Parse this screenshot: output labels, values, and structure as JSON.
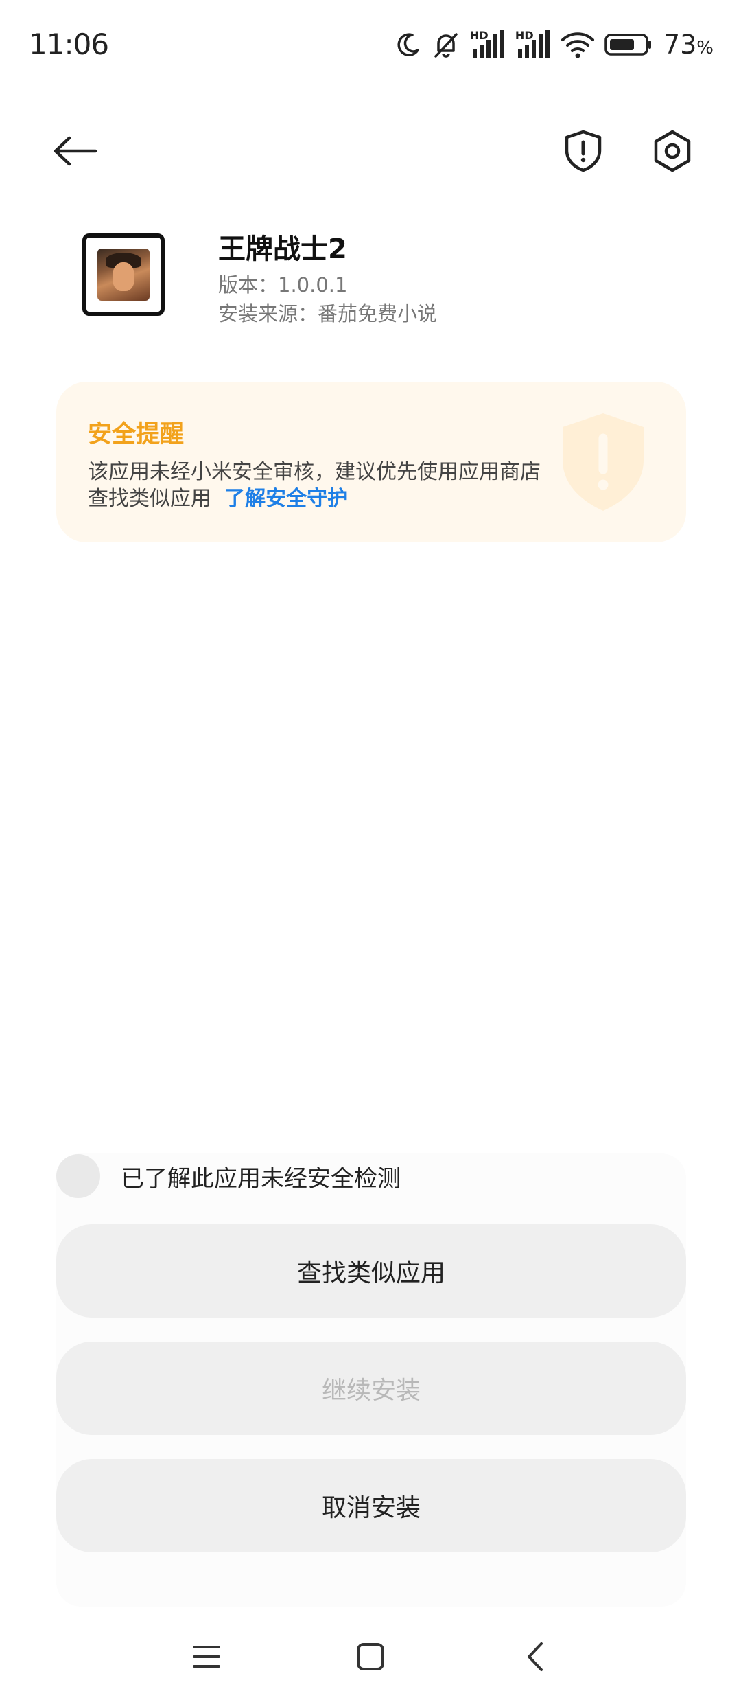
{
  "status_bar": {
    "time": "11:06",
    "network_label_1": "HD",
    "network_label_2": "HD",
    "battery_percent": "73",
    "battery_unit": "%",
    "battery_level": 0.73
  },
  "app": {
    "name": "王牌战士2",
    "version": "版本：1.0.0.1",
    "source": "安装来源：番茄免费小说"
  },
  "warning": {
    "title": "安全提醒",
    "body": "该应用未经小米安全审核，建议优先使用应用商店查找类似应用",
    "link": "了解安全守护"
  },
  "acknowledge": {
    "label": "已了解此应用未经安全检测",
    "checked": false
  },
  "buttons": {
    "find_similar": "查找类似应用",
    "continue_install": "继续安装",
    "cancel_install": "取消安装"
  },
  "colors": {
    "warning_title": "#f2a21c",
    "link": "#1e7fe6",
    "warning_bg": "#fff8ed",
    "button_bg": "#efefef",
    "disabled_text": "#b8b8b8"
  },
  "icons": {
    "back": "arrow-left-icon",
    "security": "shield-exclamation-icon",
    "settings": "gear-icon",
    "nav_menu": "hamburger-icon",
    "nav_home": "square-icon",
    "nav_back": "chevron-left-icon"
  }
}
